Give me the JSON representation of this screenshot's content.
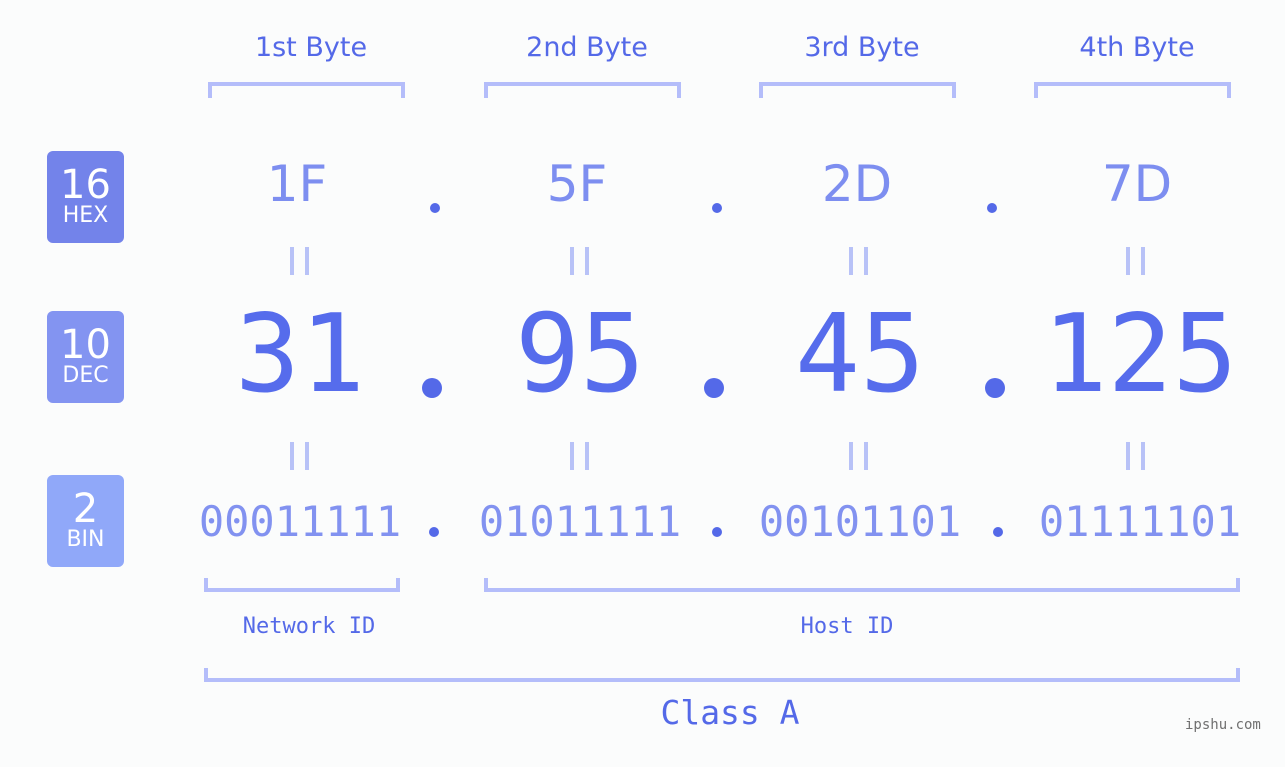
{
  "byte_labels": [
    "1st Byte",
    "2nd Byte",
    "3rd Byte",
    "4th Byte"
  ],
  "badges": [
    {
      "num": "16",
      "label": "HEX",
      "color": "#7383ea"
    },
    {
      "num": "10",
      "label": "DEC",
      "color": "#8394f1"
    },
    {
      "num": "2",
      "label": "BIN",
      "color": "#90a8f9"
    }
  ],
  "hex": [
    "1F",
    "5F",
    "2D",
    "7D"
  ],
  "dec": [
    "31",
    "95",
    "45",
    "125"
  ],
  "bin": [
    "00011111",
    "01011111",
    "00101101",
    "01111101"
  ],
  "separator": ".",
  "network_label": "Network ID",
  "host_label": "Host ID",
  "class_label": "Class A",
  "watermark": "ipshu.com"
}
